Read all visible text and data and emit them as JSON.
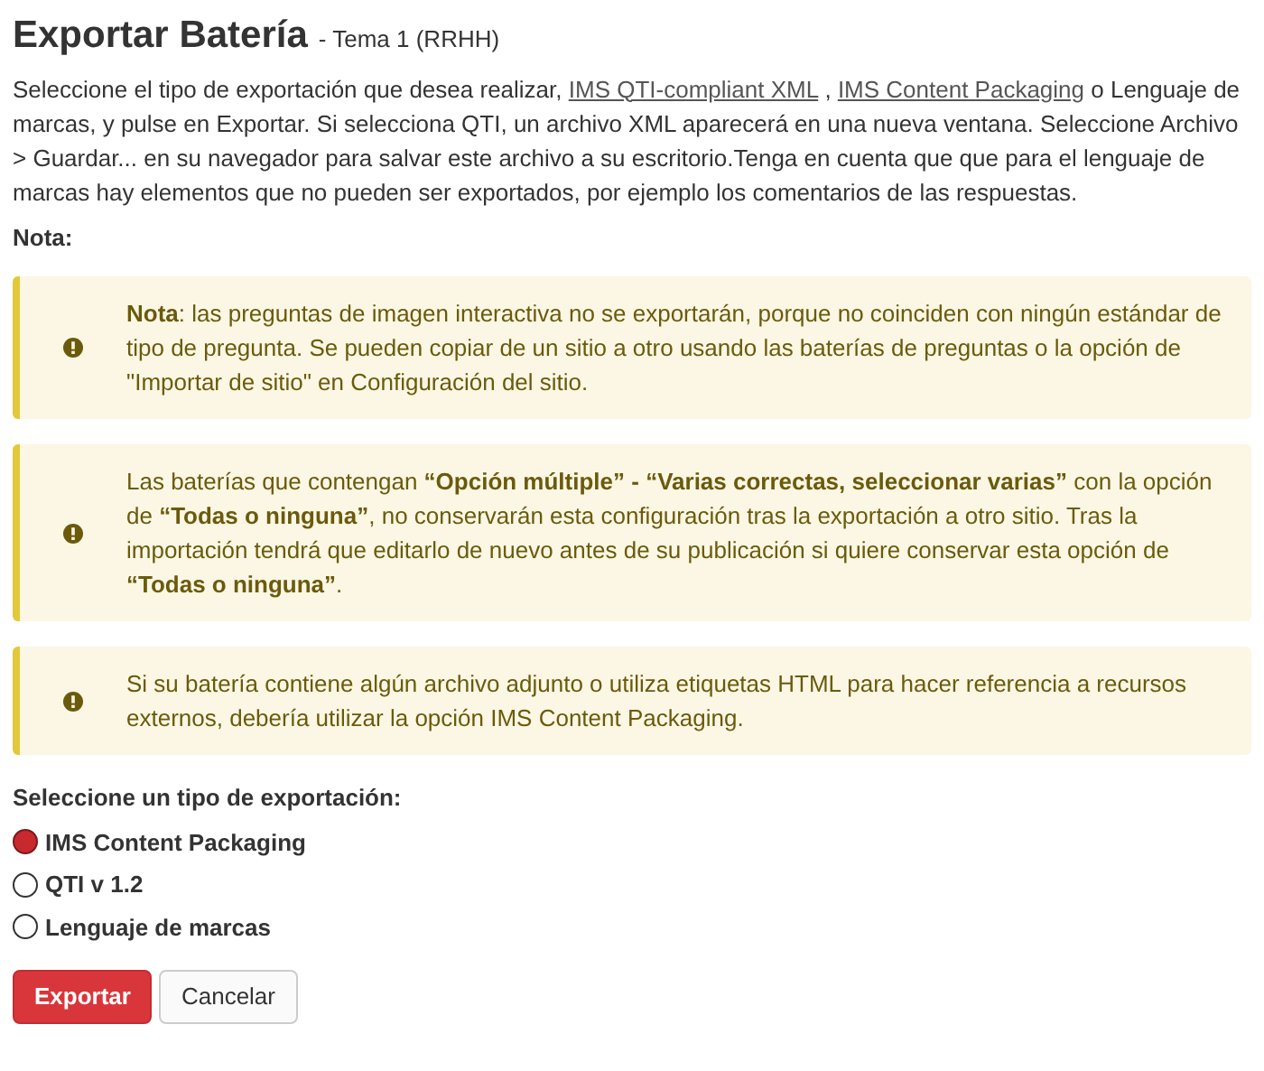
{
  "title": "Exportar Batería",
  "subtitle": "- Tema 1 (RRHH)",
  "intro": [
    {
      "kind": "text",
      "text": "Seleccione el tipo de exportación que desea realizar, "
    },
    {
      "kind": "link",
      "text": "IMS QTI-compliant XML"
    },
    {
      "kind": "text",
      "text": " , "
    },
    {
      "kind": "link",
      "text": "IMS Content Packaging"
    },
    {
      "kind": "text",
      "text": " o Lenguaje de marcas, y pulse en Exportar. Si selecciona QTI, un archivo XML aparecerá en una nueva ventana. Seleccione Archivo > Guardar... en su navegador para salvar este archivo a su escritorio.Tenga en cuenta que que para el lenguaje de marcas hay elementos que no pueden ser exportados, por ejemplo los comentarios de las respuestas."
    }
  ],
  "note_label": "Nota:",
  "alerts": [
    {
      "text": "**Nota**: las preguntas de imagen interactiva no se exportarán, porque no coinciden con ningún estándar de tipo de pregunta. Se pueden copiar de un sitio a otro usando las baterías de preguntas o la opción de \"Importar de sitio\" en Configuración del sitio."
    },
    {
      "text": "Las baterías que contengan **“Opción múltiple” - “Varias correctas, seleccionar varias”** con la opción de **“Todas o ninguna”**, no conservarán esta configuración tras la exportación a otro sitio. Tras la importación tendrá que editarlo de nuevo antes de su publicación si quiere conservar esta opción de **“Todas o ninguna”**."
    },
    {
      "text": "Si su batería contiene algún archivo adjunto o utiliza etiquetas HTML para hacer referencia a recursos externos, debería utilizar la opción IMS Content Packaging."
    }
  ],
  "export_label": "Seleccione un tipo de exportación:",
  "options": [
    {
      "label": "IMS Content Packaging",
      "selected": true
    },
    {
      "label": "QTI v 1.2",
      "selected": false
    },
    {
      "label": "Lenguaje de marcas",
      "selected": false
    }
  ],
  "buttons": [
    {
      "label": "Exportar",
      "kind": "primary"
    },
    {
      "label": "Cancelar",
      "kind": "secondary"
    }
  ]
}
